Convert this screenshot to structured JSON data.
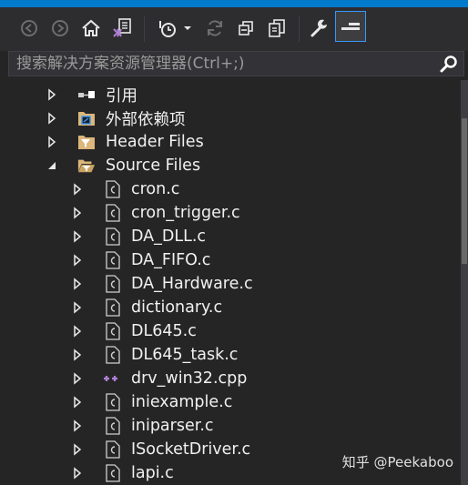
{
  "search": {
    "placeholder": "搜索解决方案资源管理器(Ctrl+;)"
  },
  "tree": [
    {
      "label": "引用",
      "icon": "references-icon",
      "expanded": false
    },
    {
      "label": "外部依赖项",
      "icon": "external-deps-icon",
      "expanded": false
    },
    {
      "label": "Header Files",
      "icon": "filter-folder-icon",
      "expanded": false
    },
    {
      "label": "Source Files",
      "icon": "filter-folder-open-icon",
      "expanded": true
    },
    {
      "label": "cron.c",
      "icon": "c-file-icon",
      "expanded": false
    },
    {
      "label": "cron_trigger.c",
      "icon": "c-file-icon",
      "expanded": false
    },
    {
      "label": "DA_DLL.c",
      "icon": "c-file-icon",
      "expanded": false
    },
    {
      "label": "DA_FIFO.c",
      "icon": "c-file-icon",
      "expanded": false
    },
    {
      "label": "DA_Hardware.c",
      "icon": "c-file-icon",
      "expanded": false
    },
    {
      "label": "dictionary.c",
      "icon": "c-file-icon",
      "expanded": false
    },
    {
      "label": "DL645.c",
      "icon": "c-file-icon",
      "expanded": false
    },
    {
      "label": "DL645_task.c",
      "icon": "c-file-icon",
      "expanded": false
    },
    {
      "label": "drv_win32.cpp",
      "icon": "cpp-file-icon",
      "expanded": false
    },
    {
      "label": "iniexample.c",
      "icon": "c-file-icon",
      "expanded": false
    },
    {
      "label": "iniparser.c",
      "icon": "c-file-icon",
      "expanded": false
    },
    {
      "label": "ISocketDriver.c",
      "icon": "c-file-icon",
      "expanded": false
    },
    {
      "label": "lapi.c",
      "icon": "c-file-icon",
      "expanded": false
    }
  ],
  "watermark": "知乎 @Peekaboo",
  "colors": {
    "accent": "#007acc",
    "background": "#252526",
    "text": "#f1f1f1",
    "folder": "#dcb67a",
    "cpp": "#b180d7"
  }
}
